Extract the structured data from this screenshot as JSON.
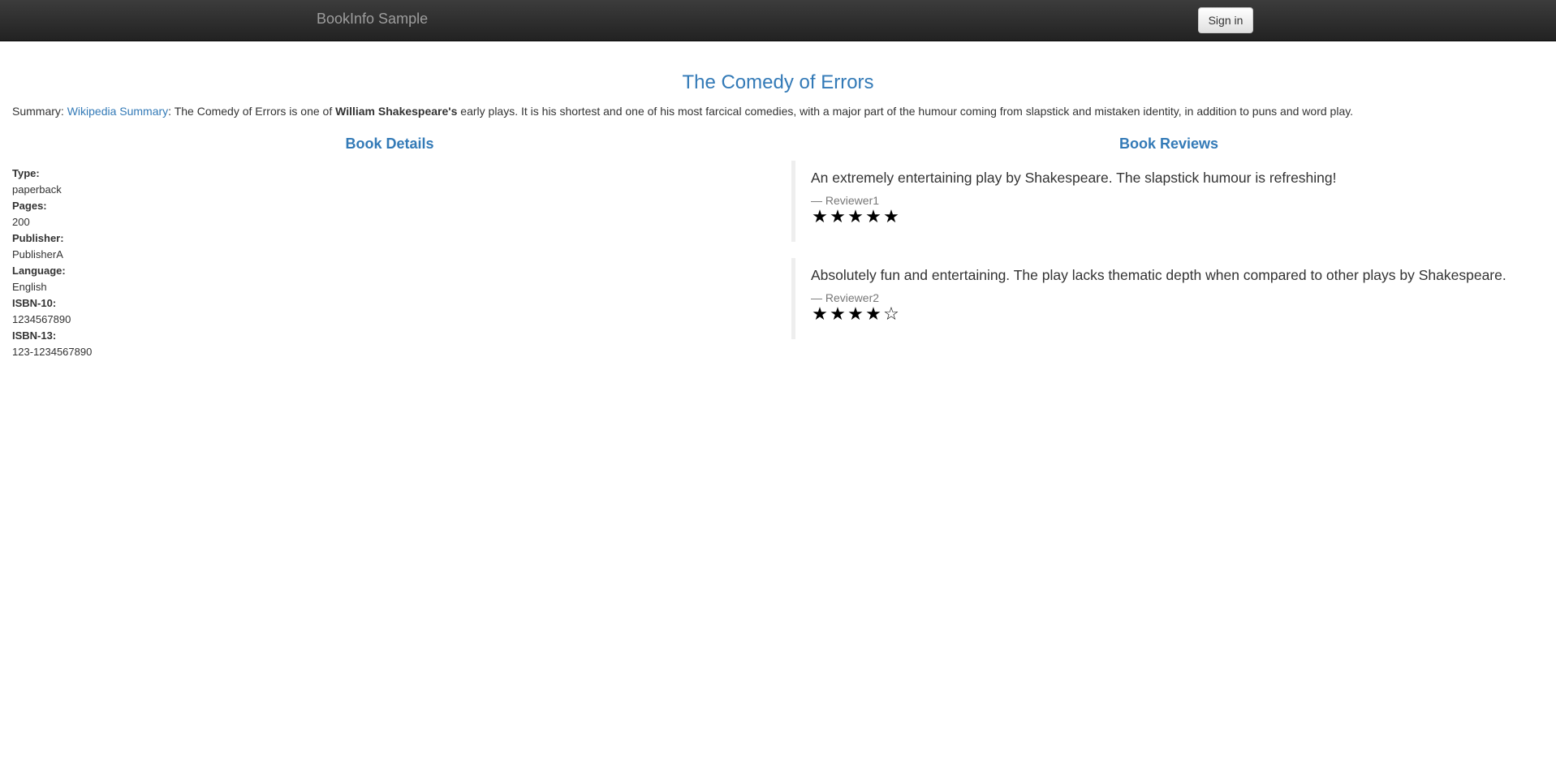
{
  "navbar": {
    "brand": "BookInfo Sample",
    "signin_label": "Sign in"
  },
  "book": {
    "title": "The Comedy of Errors",
    "summary_prefix": "Summary: ",
    "summary_link": "Wikipedia Summary",
    "summary_text_1": ": The Comedy of Errors is one of ",
    "summary_bold": "William Shakespeare's",
    "summary_text_2": " early plays. It is his shortest and one of his most farcical comedies, with a major part of the humour coming from slapstick and mistaken identity, in addition to puns and word play."
  },
  "details": {
    "heading": "Book Details",
    "fields": [
      {
        "label": "Type:",
        "value": "paperback"
      },
      {
        "label": "Pages:",
        "value": "200"
      },
      {
        "label": "Publisher:",
        "value": "PublisherA"
      },
      {
        "label": "Language:",
        "value": "English"
      },
      {
        "label": "ISBN-10:",
        "value": "1234567890"
      },
      {
        "label": "ISBN-13:",
        "value": "123-1234567890"
      }
    ]
  },
  "reviews": {
    "heading": "Book Reviews",
    "items": [
      {
        "text": "An extremely entertaining play by Shakespeare. The slapstick humour is refreshing!",
        "author": "— Reviewer1",
        "rating": 5,
        "rating_max": 5,
        "star_color": "#000000"
      },
      {
        "text": "Absolutely fun and entertaining. The play lacks thematic depth when compared to other plays by Shakespeare.",
        "author": "— Reviewer2",
        "rating": 4,
        "rating_max": 5,
        "star_color": "#000000"
      }
    ]
  },
  "icons": {
    "star_filled": "star-filled-icon",
    "star_empty": "star-empty-icon"
  }
}
